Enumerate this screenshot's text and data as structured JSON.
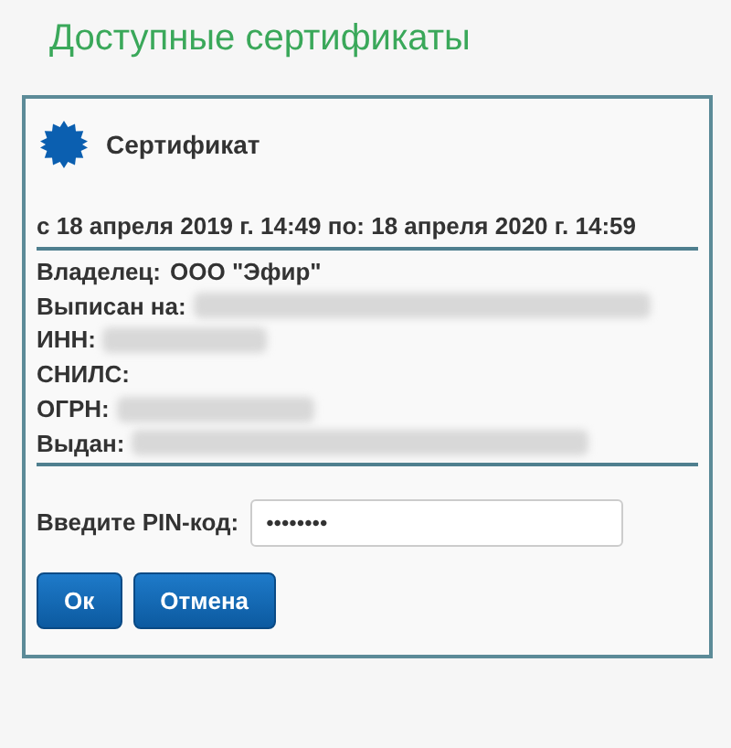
{
  "page_title": "Доступные сертификаты",
  "certificate": {
    "title": "Сертификат",
    "validity": "с 18 апреля 2019 г. 14:49 по: 18 апреля 2020 г. 14:59",
    "fields": [
      {
        "label": "Владелец:",
        "value": "ООО \"Эфир\"",
        "redacted": false
      },
      {
        "label": "Выписан на:",
        "redacted": true
      },
      {
        "label": "ИНН:",
        "redacted": true
      },
      {
        "label": "СНИЛС:",
        "redacted": false
      },
      {
        "label": "ОГРН:",
        "redacted": true
      },
      {
        "label": "Выдан:",
        "redacted": true
      }
    ]
  },
  "pin": {
    "label": "Введите PIN-код:",
    "value": "••••••••"
  },
  "buttons": [
    "Ок",
    "Отмена"
  ]
}
